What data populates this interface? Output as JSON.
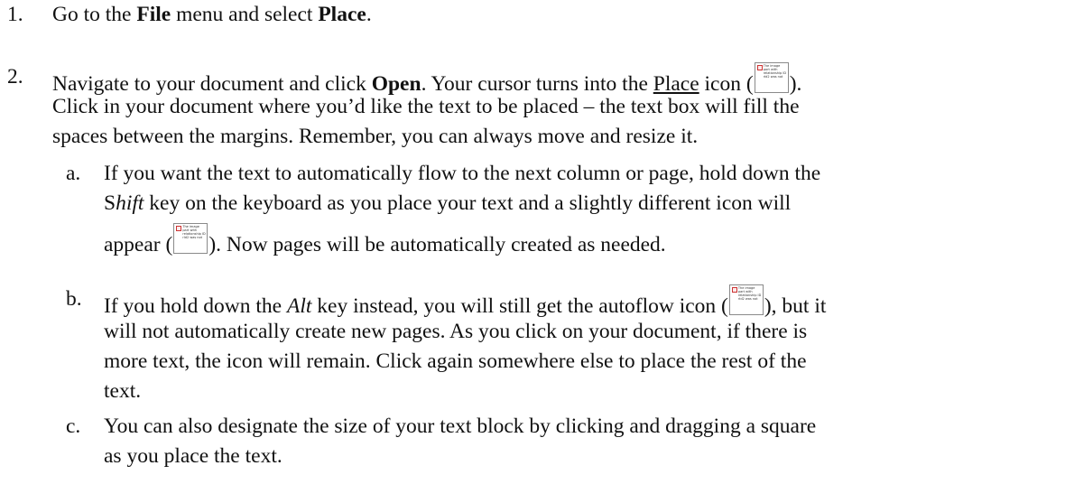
{
  "steps": [
    {
      "number": "1.",
      "parts": {
        "a": "Go to the ",
        "b": "File",
        "c": " menu and select ",
        "d": "Place",
        "e": "."
      }
    },
    {
      "number": "2.",
      "line1": {
        "a": "Navigate to your document and click ",
        "b": "Open",
        "c": ". Your cursor turns into the ",
        "d": "Place",
        "e": " icon (",
        "f": ")."
      },
      "line2": "Click in your document where you’d like the text to be placed – the text box will fill the",
      "line3": "spaces between the margins. Remember, you can always move and resize it."
    }
  ],
  "substeps": [
    {
      "letter": "a.",
      "line1": "If you want the text to automatically flow to the next column or page, hold down the",
      "line2": {
        "a": "S",
        "b": "hift",
        "c": " key on the keyboard as you place your text and a slightly different icon will"
      },
      "line3": {
        "a": "appear (",
        "b": ").  Now pages will be automatically created as needed."
      }
    },
    {
      "letter": "b.",
      "line1": {
        "a": "If you hold down the ",
        "b": "Alt",
        "c": " key instead, you will still get the autoflow icon (",
        "d": "), but it"
      },
      "line2": "will not automatically create new pages. As you click on your document, if there is",
      "line3": "more text, the icon will remain. Click again somewhere else to place the rest of the",
      "line4": "text."
    },
    {
      "letter": "c.",
      "line1": "You can also designate the size of your text block by clicking and dragging a square",
      "line2": "as you place the text."
    }
  ],
  "image_placeholder_text": "The image part with relationship ID rId2 was not found in the file.",
  "icons": [
    "place-icon",
    "autoflow-shift-icon",
    "autoflow-alt-icon"
  ]
}
